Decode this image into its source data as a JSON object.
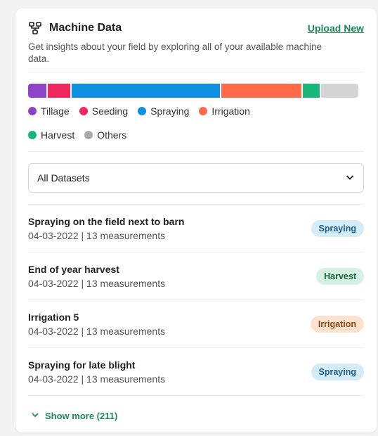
{
  "header": {
    "title": "Machine Data",
    "upload_label": "Upload New",
    "description": "Get insights about your field by exploring all of your available machine data."
  },
  "distribution": {
    "segments": [
      {
        "name": "Tillage",
        "share": 0.056,
        "color": "#8e44c9"
      },
      {
        "name": "Seeding",
        "share": 0.068,
        "color": "#f0285e"
      },
      {
        "name": "Spraying",
        "share": 0.45,
        "color": "#0f8fe0"
      },
      {
        "name": "Irrigation",
        "share": 0.245,
        "color": "#ff6a4b"
      },
      {
        "name": "Harvest",
        "share": 0.05,
        "color": "#19b67a"
      },
      {
        "name": "Others",
        "share": 0.114,
        "color": "#d4d4d4"
      }
    ],
    "legend": [
      {
        "label": "Tillage",
        "color": "#8e44c9"
      },
      {
        "label": "Seeding",
        "color": "#f0285e"
      },
      {
        "label": "Spraying",
        "color": "#0f8fe0"
      },
      {
        "label": "Irrigation",
        "color": "#ff6a4b"
      },
      {
        "label": "Harvest",
        "color": "#19b67a"
      },
      {
        "label": "Others",
        "color": "#a9a9a9"
      }
    ]
  },
  "filter": {
    "selected": "All Datasets"
  },
  "datasets": [
    {
      "title": "Spraying on the field next to barn",
      "date": "04-03-2022",
      "measurements": "13 measurements",
      "tag": "Spraying",
      "tag_bg": "#d4ecf7",
      "tag_fg": "#1b5f84"
    },
    {
      "title": "End of year harvest",
      "date": "04-03-2022",
      "measurements": "13 measurements",
      "tag": "Harvest",
      "tag_bg": "#d6f1e3",
      "tag_fg": "#16683f"
    },
    {
      "title": "Irrigation 5",
      "date": "04-03-2022",
      "measurements": "13 measurements",
      "tag": "Irrigation",
      "tag_bg": "#fde3cf",
      "tag_fg": "#8a4a17"
    },
    {
      "title": "Spraying for late blight",
      "date": "04-03-2022",
      "measurements": "13 measurements",
      "tag": "Spraying",
      "tag_bg": "#d4ecf7",
      "tag_fg": "#1b5f84"
    }
  ],
  "footer": {
    "show_more_label": "Show more (211)"
  },
  "icons": {
    "title": "dataset-icon",
    "dropdown": "chevron-down-icon",
    "show_more": "chevron-down-icon"
  }
}
